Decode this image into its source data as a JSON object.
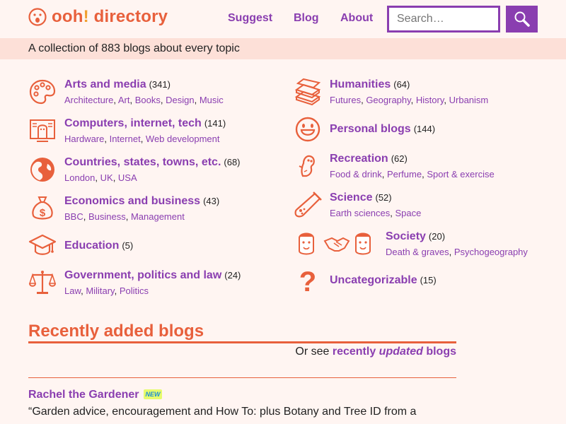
{
  "header": {
    "logo_text": "ooh",
    "logo_bang": "!",
    "logo_rest": " directory",
    "nav": [
      "Suggest",
      "Blog",
      "About"
    ],
    "search_placeholder": "Search…"
  },
  "tagline": "A collection of 883 blogs about every topic",
  "colors": {
    "accent": "#e8603c",
    "link": "#8a3eb0",
    "tagline_bg": "#fde0d8",
    "page_bg": "#fff5f2"
  },
  "left_categories": [
    {
      "name": "Arts and media",
      "count": "(341)",
      "icon": "palette-icon",
      "subs": [
        "Architecture",
        "Art",
        "Books",
        "Design",
        "Music"
      ]
    },
    {
      "name": "Computers, internet, tech",
      "count": "(141)",
      "icon": "computer-icon",
      "subs": [
        "Hardware",
        "Internet",
        "Web development"
      ]
    },
    {
      "name": "Countries, states, towns, etc.",
      "count": "(68)",
      "icon": "globe-icon",
      "subs": [
        "London",
        "UK",
        "USA"
      ]
    },
    {
      "name": "Economics and business",
      "count": "(43)",
      "icon": "money-bag-icon",
      "subs": [
        "BBC",
        "Business",
        "Management"
      ]
    },
    {
      "name": "Education",
      "count": "(5)",
      "icon": "graduation-cap-icon",
      "subs": []
    },
    {
      "name": "Government, politics and law",
      "count": "(24)",
      "icon": "scales-icon",
      "subs": [
        "Law",
        "Military",
        "Politics"
      ]
    }
  ],
  "right_categories": [
    {
      "name": "Humanities",
      "count": "(64)",
      "icon": "books-icon",
      "subs": [
        "Futures",
        "Geography",
        "History",
        "Urbanism"
      ]
    },
    {
      "name": "Personal blogs",
      "count": "(144)",
      "icon": "smiley-icon",
      "subs": []
    },
    {
      "name": "Recreation",
      "count": "(62)",
      "icon": "character-icon",
      "subs": [
        "Food & drink",
        "Perfume",
        "Sport & exercise"
      ]
    },
    {
      "name": "Science",
      "count": "(52)",
      "icon": "test-tube-icon",
      "subs": [
        "Earth sciences",
        "Space"
      ]
    },
    {
      "name": "Society",
      "count": "(20)",
      "icon": "handshake-people-icon",
      "subs": [
        "Death & graves",
        "Psychogeography"
      ]
    },
    {
      "name": "Uncategorizable",
      "count": "(15)",
      "icon": "question-mark-icon",
      "subs": []
    }
  ],
  "recent": {
    "heading": "Recently added blogs",
    "or_see_prefix": "Or see ",
    "or_see_link_a": "recently ",
    "or_see_link_em": "updated",
    "or_see_link_b": " blogs",
    "entries": [
      {
        "title": "Rachel the Gardener",
        "badge": "NEW",
        "description": "“Garden advice, encouragement and How To: plus Botany and Tree ID from a"
      }
    ]
  }
}
